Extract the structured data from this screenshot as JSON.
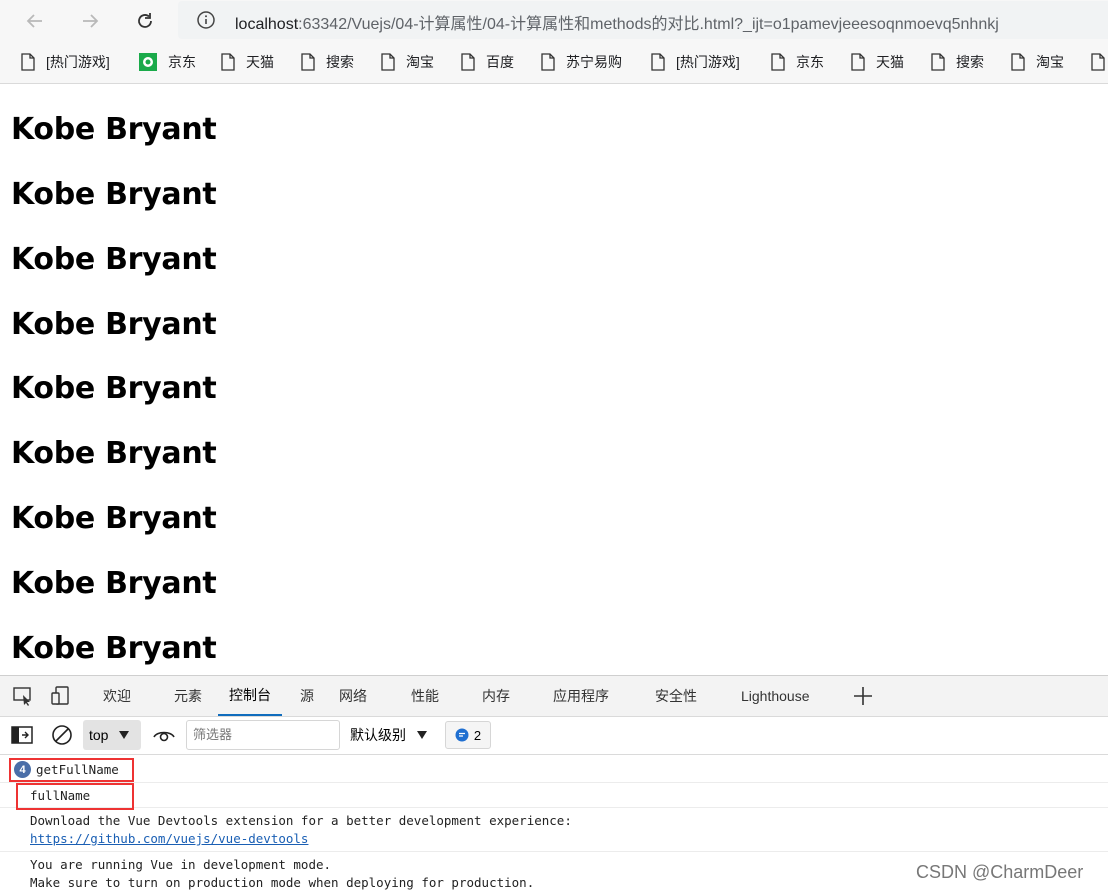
{
  "browser": {
    "url_host": "localhost",
    "url_path": ":63342/Vuejs/04-计算属性/04-计算属性和methods的对比.html?_ijt=o1pamevjeeesoqnmoevq5nhnkj"
  },
  "bookmarks": [
    {
      "label": "[热门游戏]",
      "icon": "page-icon"
    },
    {
      "label": "京东",
      "icon": "jd-icon"
    },
    {
      "label": "天猫",
      "icon": "page-icon"
    },
    {
      "label": "搜索",
      "icon": "page-icon"
    },
    {
      "label": "淘宝",
      "icon": "page-icon"
    },
    {
      "label": "百度",
      "icon": "page-icon"
    },
    {
      "label": "苏宁易购",
      "icon": "page-icon"
    },
    {
      "label": "[热门游戏]",
      "icon": "page-icon"
    },
    {
      "label": "京东",
      "icon": "page-icon"
    },
    {
      "label": "天猫",
      "icon": "page-icon"
    },
    {
      "label": "搜索",
      "icon": "page-icon"
    },
    {
      "label": "淘宝",
      "icon": "page-icon"
    }
  ],
  "page": {
    "headings": [
      "Kobe Bryant",
      "Kobe Bryant",
      "Kobe Bryant",
      "Kobe Bryant",
      "Kobe Bryant",
      "Kobe Bryant",
      "Kobe Bryant",
      "Kobe Bryant",
      "Kobe Bryant"
    ]
  },
  "devtools": {
    "tabs": [
      "欢迎",
      "元素",
      "控制台",
      "源",
      "网络",
      "性能",
      "内存",
      "应用程序",
      "安全性",
      "Lighthouse"
    ],
    "active_tab": "控制台",
    "context": "top",
    "filter_placeholder": "筛选器",
    "level": "默认级别",
    "issues_count": "2"
  },
  "console": {
    "repeat_count": "4",
    "line1": "getFullName",
    "line2": "fullName",
    "devtools_msg": "Download the Vue Devtools extension for a better development experience:",
    "devtools_link": "https://github.com/vuejs/vue-devtools",
    "mode_msg1": "You are running Vue in development mode.",
    "mode_msg2": "Make sure to turn on production mode when deploying for production."
  },
  "watermark": "CSDN @CharmDeer",
  "colors": {
    "highlight_box": "#ee3333",
    "active_tab": "#0f6cbd",
    "link": "#1a5fb4",
    "badge": "#4a6ea8"
  }
}
